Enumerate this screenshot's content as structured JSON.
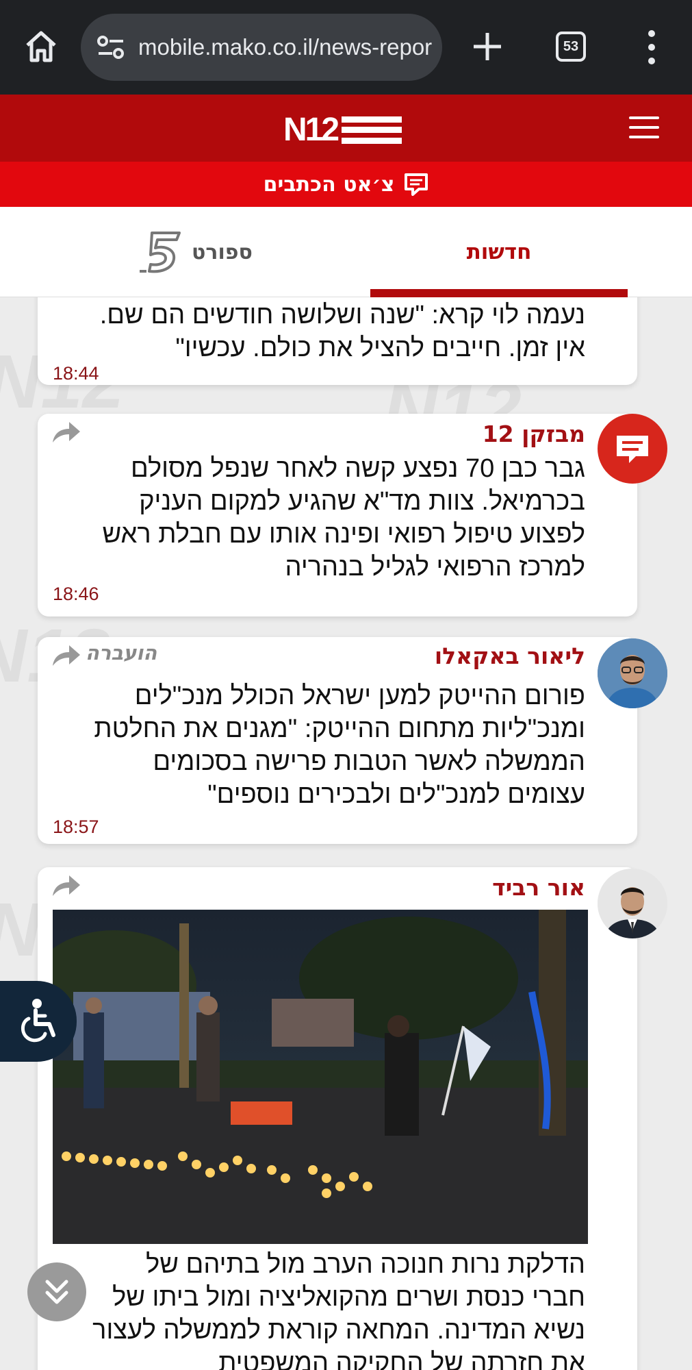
{
  "browser": {
    "url": "mobile.mako.co.il/news-repor",
    "tab_count": "53"
  },
  "header": {
    "logo_text": "N12",
    "chat_label": "צ׳אט הכתבים"
  },
  "tabs": [
    {
      "label": "חדשות",
      "active": true
    },
    {
      "label": "ספורט",
      "active": false
    }
  ],
  "feed": [
    {
      "author": "",
      "text": "נעמה לוי קרא: \"שנה ושלושה חודשים הם שם. אין זמן. חייבים להציל את כולם. עכשיו\"",
      "time": "18:44"
    },
    {
      "author": "מבזקן 12",
      "text": "גבר כבן 70 נפצע קשה לאחר שנפל מסולם בכרמיאל. צוות מד\"א שהגיע למקום העניק לפצוע טיפול רפואי ופינה אותו עם חבלת ראש למרכז הרפואי לגליל בנהריה",
      "time": "18:46"
    },
    {
      "author": "ליאור באקאלו",
      "forwarded": "הועברה",
      "text": "פורום ההייטק למען ישראל הכולל מנכ\"לים ומנכ\"ליות מתחום ההייטק: \"מגנים את החלטת הממשלה לאשר הטבות פרישה בסכומים עצומים למנכ\"לים ולבכירים נוספים\"",
      "time": "18:57"
    },
    {
      "author": "אור רביד",
      "text": "הדלקת נרות חנוכה הערב מול בתיהם של חברי כנסת ושרים מהקואליציה ומול ביתו של נשיא המדינה. המחאה קוראת לממשלה לעצור את חזרתה של החקיקה המשפטית"
    }
  ],
  "colors": {
    "brand_dark_red": "#b10a0c",
    "brand_red": "#e2080e",
    "browser_bg": "#1f2124"
  }
}
